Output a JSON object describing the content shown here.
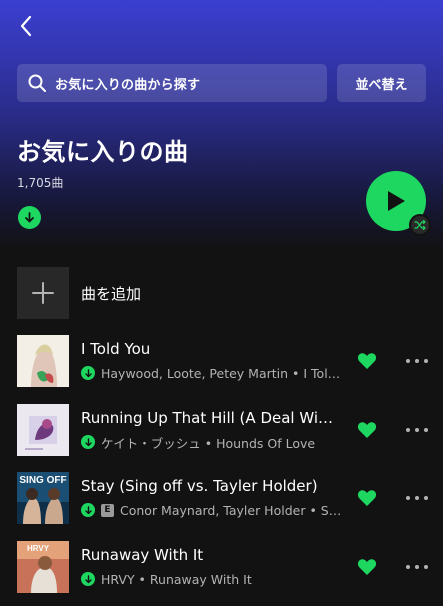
{
  "header": {
    "search_placeholder": "お気に入りの曲から探す",
    "sort_label": "並べ替え",
    "title": "お気に入りの曲",
    "track_count": "1,705曲"
  },
  "add_song_label": "曲を追加",
  "colors": {
    "accent": "#1ed760",
    "header_gradient_top": "#3b3fd1",
    "background": "#121212"
  },
  "tracks": [
    {
      "title": "I Told You",
      "meta": "Haywood, Loote, Petey Martin • I Tol…",
      "explicit": false,
      "liked": true,
      "downloaded": true
    },
    {
      "title": "Running Up That Hill (A Deal Wi…",
      "meta": "ケイト・ブッシュ • Hounds Of Love",
      "explicit": false,
      "liked": true,
      "downloaded": true
    },
    {
      "title": "Stay (Sing off vs. Tayler Holder)",
      "meta": "Conor Maynard, Tayler Holder • S…",
      "explicit": true,
      "explicit_label": "E",
      "liked": true,
      "downloaded": true
    },
    {
      "title": "Runaway With It",
      "meta": "HRVY • Runaway With It",
      "explicit": false,
      "liked": true,
      "downloaded": true
    }
  ],
  "cover_text": {
    "stay_cover": "SING OFF",
    "runaway_cover": "HRVY"
  }
}
